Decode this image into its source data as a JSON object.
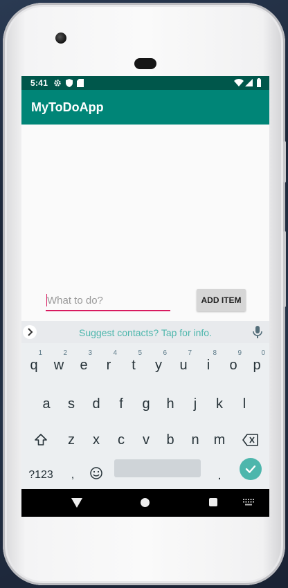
{
  "status_bar": {
    "time": "5:41",
    "icons": [
      "gear-icon",
      "shield-icon",
      "sd-card-icon",
      "wifi-icon",
      "signal-icon",
      "battery-icon"
    ]
  },
  "app_bar": {
    "title": "MyToDoApp",
    "color": "#008577",
    "status_color": "#00574b"
  },
  "todo_input": {
    "placeholder": "What to do?",
    "value": "",
    "underline_color": "#d81b60"
  },
  "add_button": {
    "label": "ADD ITEM"
  },
  "suggestion_bar": {
    "text": "Suggest contacts? Tap for info.",
    "text_color": "#4db6ac"
  },
  "keyboard": {
    "row1": [
      {
        "k": "q",
        "h": "1"
      },
      {
        "k": "w",
        "h": "2"
      },
      {
        "k": "e",
        "h": "3"
      },
      {
        "k": "r",
        "h": "4"
      },
      {
        "k": "t",
        "h": "5"
      },
      {
        "k": "y",
        "h": "6"
      },
      {
        "k": "u",
        "h": "7"
      },
      {
        "k": "i",
        "h": "8"
      },
      {
        "k": "o",
        "h": "9"
      },
      {
        "k": "p",
        "h": "0"
      }
    ],
    "row2": [
      "a",
      "s",
      "d",
      "f",
      "g",
      "h",
      "j",
      "k",
      "l"
    ],
    "row3": [
      "z",
      "x",
      "c",
      "v",
      "b",
      "n",
      "m"
    ],
    "symbols_key": "?123",
    "comma_key": ",",
    "period_key": ".",
    "enter_color": "#4db6ac"
  },
  "nav_bar": {
    "icons": [
      "back-icon",
      "home-icon",
      "recents-icon",
      "keyboard-switch-icon"
    ]
  }
}
